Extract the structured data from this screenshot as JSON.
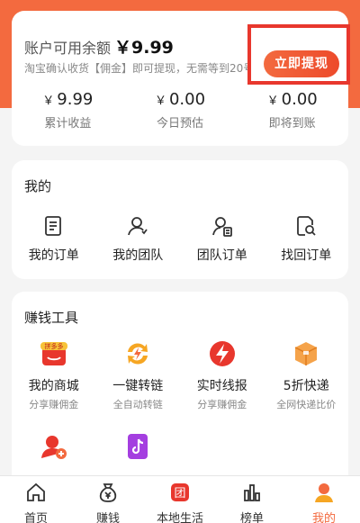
{
  "colors": {
    "accent": "#f36a3f",
    "highlight_border": "#e8372d"
  },
  "balance": {
    "title": "账户可用余额",
    "amount": "￥9.99",
    "subtitle": "淘宝确认收货【佣金】即可提现，无需等到20号",
    "withdraw_label": "立即提现",
    "stats": [
      {
        "currency": "￥",
        "value": "9.99",
        "label": "累计收益"
      },
      {
        "currency": "￥",
        "value": "0.00",
        "label": "今日预估"
      },
      {
        "currency": "￥",
        "value": "0.00",
        "label": "即将到账"
      }
    ]
  },
  "mine": {
    "title": "我的",
    "items": [
      {
        "label": "我的订单",
        "icon": "order-list-icon"
      },
      {
        "label": "我的团队",
        "icon": "team-icon"
      },
      {
        "label": "团队订单",
        "icon": "team-order-icon"
      },
      {
        "label": "找回订单",
        "icon": "search-document-icon"
      }
    ]
  },
  "tools": {
    "title": "赚钱工具",
    "pdd_badge": "拼多多",
    "items": [
      {
        "name": "我的商城",
        "desc": "分享赚佣金",
        "icon": "pinduoduo-shop-icon"
      },
      {
        "name": "一键转链",
        "desc": "全自动转链",
        "icon": "convert-link-icon"
      },
      {
        "name": "实时线报",
        "desc": "分享赚佣金",
        "icon": "lightning-icon"
      },
      {
        "name": "5折快递",
        "desc": "全网快递比价",
        "icon": "package-icon"
      },
      {
        "name": "",
        "desc": "",
        "icon": "add-user-icon"
      },
      {
        "name": "",
        "desc": "",
        "icon": "tiktok-icon"
      }
    ]
  },
  "bottom_nav": {
    "group_badge": "团",
    "items": [
      {
        "label": "首页",
        "icon": "home-icon"
      },
      {
        "label": "赚钱",
        "icon": "money-bag-icon"
      },
      {
        "label": "本地生活",
        "icon": "group-buy-icon"
      },
      {
        "label": "榜单",
        "icon": "ranking-icon"
      },
      {
        "label": "我的",
        "icon": "profile-icon",
        "active": true
      }
    ]
  }
}
